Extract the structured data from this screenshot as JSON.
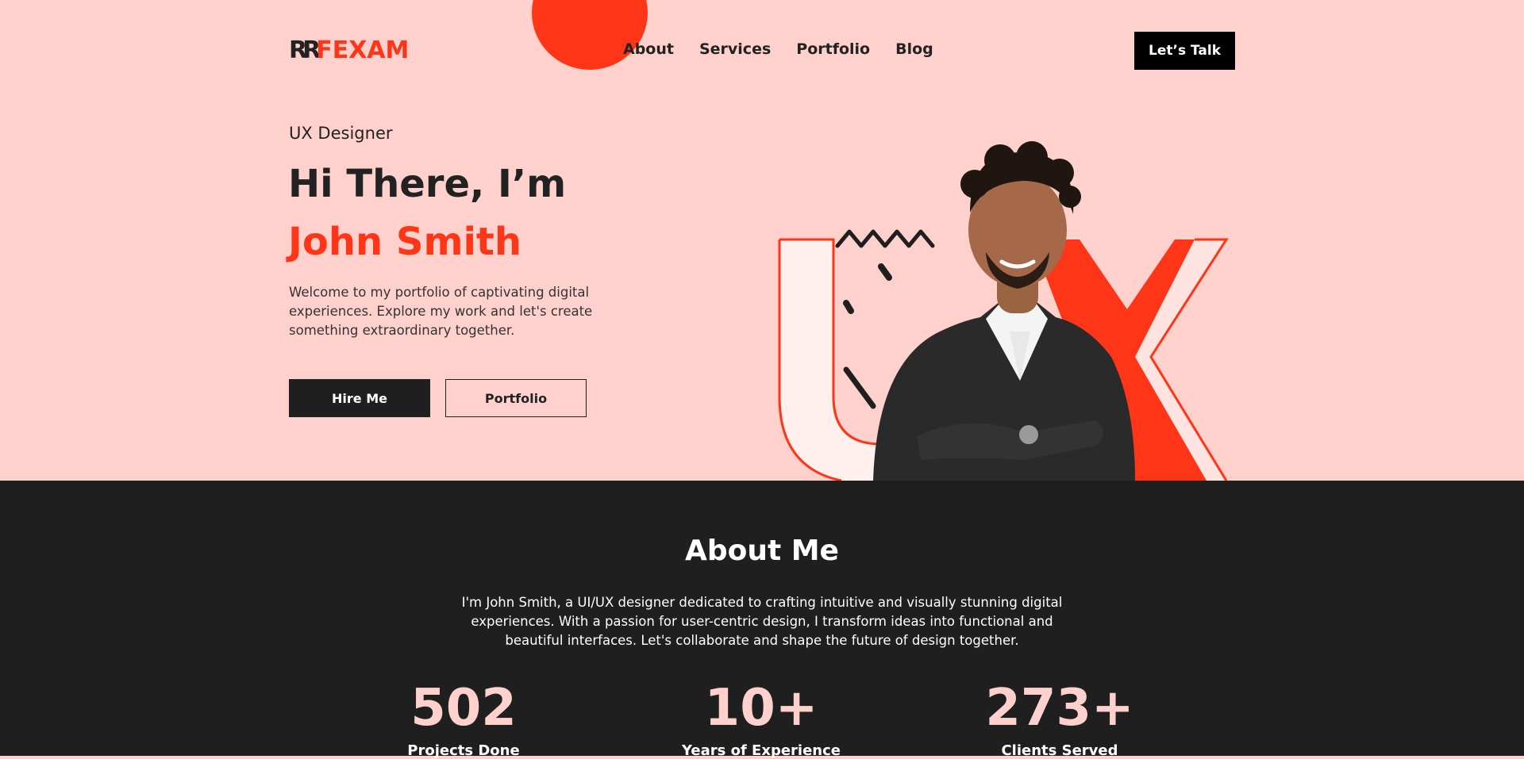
{
  "brand": {
    "mark": "RR",
    "mark_f": "F",
    "name": "EXAM",
    "accent": "#ff3517",
    "pink": "#ffd1cd",
    "dark": "#1f1f1f"
  },
  "nav": {
    "items": [
      "About",
      "Services",
      "Portfolio",
      "Blog"
    ],
    "cta": "Let’s Talk"
  },
  "hero": {
    "subtitle": "UX Designer",
    "greeting": "Hi There, I’m",
    "name": "John Smith",
    "description": "Welcome to my portfolio of captivating digital experiences. Explore my work and let's create something extraordinary together.",
    "hire_button": "Hire Me",
    "portfolio_button": "Portfolio",
    "art_letters": "UX"
  },
  "about": {
    "title": "About Me",
    "text": "I'm John Smith, a UI/UX designer dedicated to crafting intuitive and visually stunning digital experiences. With a passion for user-centric design, I transform ideas into functional and beautiful interfaces. Let's collaborate and shape the future of design together.",
    "stats": [
      {
        "value": "502",
        "label": "Projects Done"
      },
      {
        "value": "10+",
        "label": "Years of Experience"
      },
      {
        "value": "273+",
        "label": "Clients Served"
      }
    ]
  }
}
